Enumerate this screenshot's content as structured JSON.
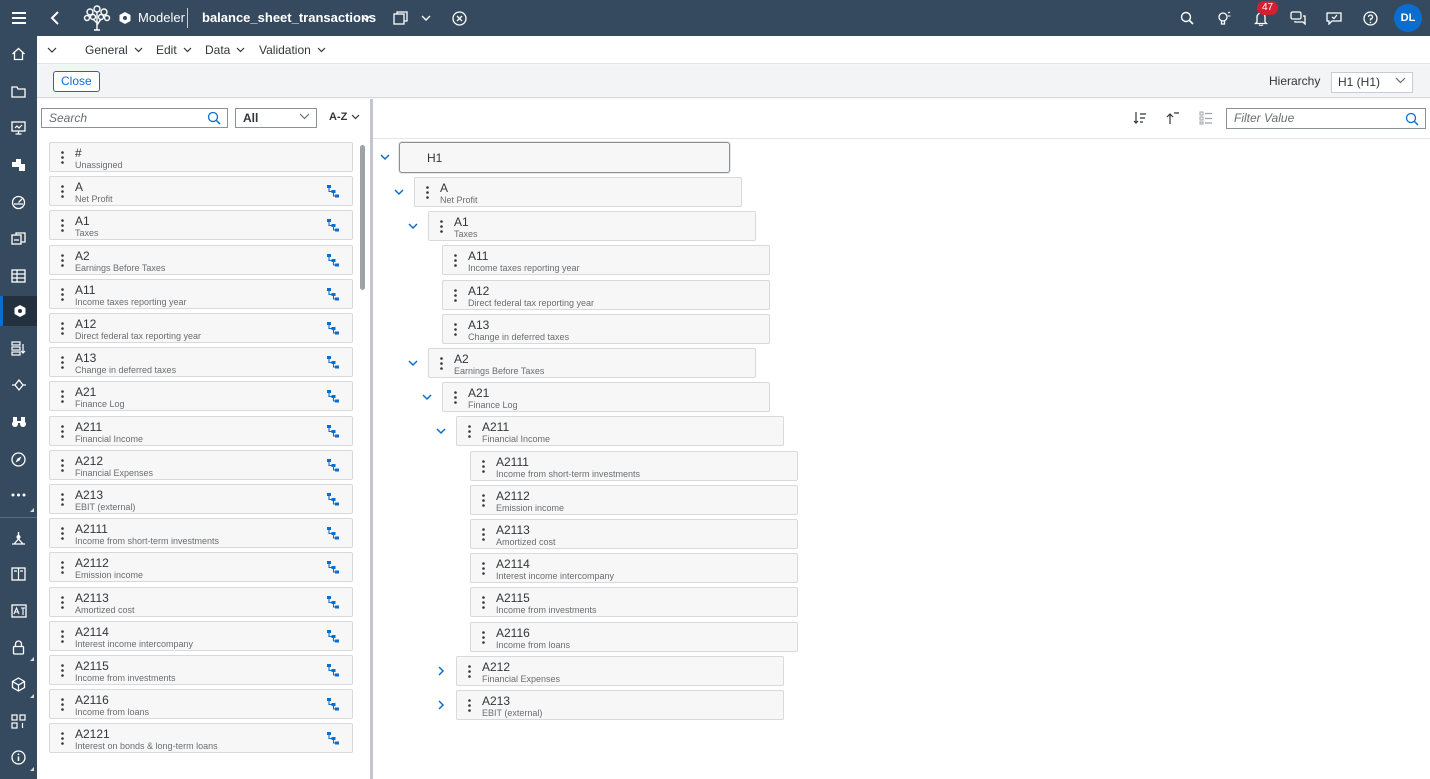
{
  "shell": {
    "app_name": "Modeler",
    "file_name": "balance_sheet_transactions",
    "notification_count": "47",
    "avatar_initials": "DL",
    "accent": "#0a6ed1",
    "bar_color": "#354a5f"
  },
  "menu": {
    "items": [
      {
        "label": "General"
      },
      {
        "label": "Edit"
      },
      {
        "label": "Data"
      },
      {
        "label": "Validation"
      }
    ]
  },
  "toolbar": {
    "close_label": "Close",
    "hierarchy_label": "Hierarchy",
    "hierarchy_value": "H1 (H1)"
  },
  "left": {
    "search_placeholder": "Search",
    "filter_value": "All",
    "sort_label": "A-Z",
    "items": [
      {
        "code": "#",
        "desc": "Unassigned",
        "has_hier": false
      },
      {
        "code": "A",
        "desc": "Net Profit",
        "has_hier": true
      },
      {
        "code": "A1",
        "desc": "Taxes",
        "has_hier": true
      },
      {
        "code": "A2",
        "desc": "Earnings Before Taxes",
        "has_hier": true
      },
      {
        "code": "A11",
        "desc": "Income taxes reporting year",
        "has_hier": true
      },
      {
        "code": "A12",
        "desc": "Direct federal tax reporting year",
        "has_hier": true
      },
      {
        "code": "A13",
        "desc": "Change in deferred taxes",
        "has_hier": true
      },
      {
        "code": "A21",
        "desc": "Finance Log",
        "has_hier": true
      },
      {
        "code": "A211",
        "desc": "Financial Income",
        "has_hier": true
      },
      {
        "code": "A212",
        "desc": "Financial Expenses",
        "has_hier": true
      },
      {
        "code": "A213",
        "desc": "EBIT (external)",
        "has_hier": true
      },
      {
        "code": "A2111",
        "desc": "Income from short-term investments",
        "has_hier": true
      },
      {
        "code": "A2112",
        "desc": "Emission income",
        "has_hier": true
      },
      {
        "code": "A2113",
        "desc": "Amortized cost",
        "has_hier": true
      },
      {
        "code": "A2114",
        "desc": "Interest income intercompany",
        "has_hier": true
      },
      {
        "code": "A2115",
        "desc": "Income from investments",
        "has_hier": true
      },
      {
        "code": "A2116",
        "desc": "Income from loans",
        "has_hier": true
      },
      {
        "code": "A2121",
        "desc": "Interest on bonds & long-term loans",
        "has_hier": true
      }
    ]
  },
  "right": {
    "filter_placeholder": "Filter Value",
    "root": "H1",
    "tree": [
      {
        "code": "A",
        "desc": "Net Profit",
        "level": 1,
        "toggle": "expanded"
      },
      {
        "code": "A1",
        "desc": "Taxes",
        "level": 2,
        "toggle": "expanded"
      },
      {
        "code": "A11",
        "desc": "Income taxes reporting year",
        "level": 3,
        "toggle": "none"
      },
      {
        "code": "A12",
        "desc": "Direct federal tax reporting year",
        "level": 3,
        "toggle": "none"
      },
      {
        "code": "A13",
        "desc": "Change in deferred taxes",
        "level": 3,
        "toggle": "none"
      },
      {
        "code": "A2",
        "desc": "Earnings Before Taxes",
        "level": 2,
        "toggle": "expanded"
      },
      {
        "code": "A21",
        "desc": "Finance Log",
        "level": 3,
        "toggle": "expanded"
      },
      {
        "code": "A211",
        "desc": "Financial Income",
        "level": 4,
        "toggle": "expanded"
      },
      {
        "code": "A2111",
        "desc": "Income from short-term investments",
        "level": 5,
        "toggle": "none"
      },
      {
        "code": "A2112",
        "desc": "Emission income",
        "level": 5,
        "toggle": "none"
      },
      {
        "code": "A2113",
        "desc": "Amortized cost",
        "level": 5,
        "toggle": "none"
      },
      {
        "code": "A2114",
        "desc": "Interest income intercompany",
        "level": 5,
        "toggle": "none"
      },
      {
        "code": "A2115",
        "desc": "Income from investments",
        "level": 5,
        "toggle": "none"
      },
      {
        "code": "A2116",
        "desc": "Income from loans",
        "level": 5,
        "toggle": "none"
      },
      {
        "code": "A212",
        "desc": "Financial Expenses",
        "level": 4,
        "toggle": "collapsed"
      },
      {
        "code": "A213",
        "desc": "EBIT (external)",
        "level": 4,
        "toggle": "collapsed"
      }
    ]
  }
}
